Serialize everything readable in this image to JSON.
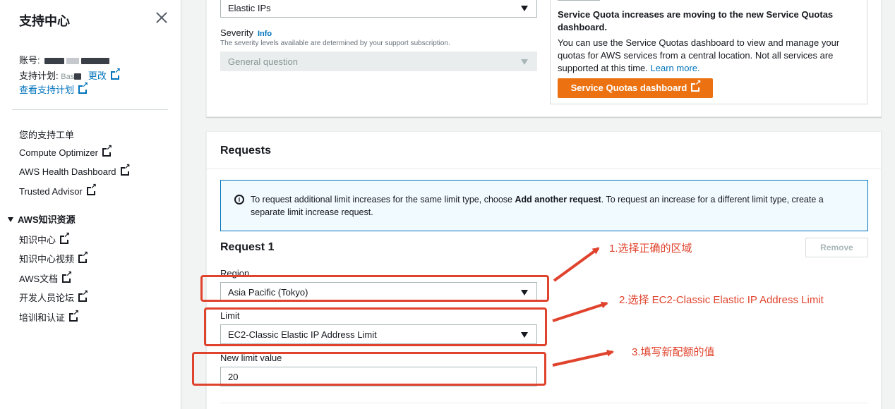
{
  "sidebar": {
    "title": "支持中心",
    "account_label": "账号:",
    "plan_label": "支持计划:",
    "plan_value_partial": "Bas",
    "change_link": "更改",
    "view_plan_link": "查看支持计划",
    "nav_items": [
      {
        "label": "您的支持工单",
        "external": false
      },
      {
        "label": "Compute Optimizer",
        "external": true
      },
      {
        "label": "AWS Health Dashboard",
        "external": true
      },
      {
        "label": "Trusted Advisor",
        "external": true
      }
    ],
    "section_title": "AWS知识资源",
    "section_items": [
      {
        "label": "知识中心"
      },
      {
        "label": "知识中心视频"
      },
      {
        "label": "AWS文档"
      },
      {
        "label": "开发人员论坛"
      },
      {
        "label": "培训和认证"
      }
    ]
  },
  "top_panel": {
    "type_select_value": "Elastic IPs",
    "severity_label": "Severity",
    "severity_info": "Info",
    "severity_desc": "The severity levels available are determined by your support subscription.",
    "severity_value": "General question",
    "quota": {
      "heading": "Service Quota increases are moving to the new Service Quotas dashboard.",
      "body": "You can use the Service Quotas dashboard to view and manage your quotas for AWS services from a central location. Not all services are supported at this time.",
      "learn_more": "Learn more.",
      "button": "Service Quotas dashboard"
    }
  },
  "requests": {
    "title": "Requests",
    "alert_prefix": "To request additional limit increases for the same limit type, choose ",
    "alert_bold": "Add another request",
    "alert_suffix": ". To request an increase for a different limit type, create a separate limit increase request.",
    "request_title": "Request 1",
    "remove_label": "Remove",
    "region_label": "Region",
    "region_value": "Asia Pacific (Tokyo)",
    "limit_label": "Limit",
    "limit_value": "EC2-Classic Elastic IP Address Limit",
    "new_limit_label": "New limit value",
    "new_limit_value": "20"
  },
  "annotations": {
    "step1": "1.选择正确的区域",
    "step2": "2.选择 EC2-Classic Elastic IP Address Limit",
    "step3": "3.填写新配额的值",
    "color": "#e0432d"
  },
  "colors": {
    "link": "#0073bb",
    "orange": "#ec7211",
    "background": "#f2f3f3"
  }
}
